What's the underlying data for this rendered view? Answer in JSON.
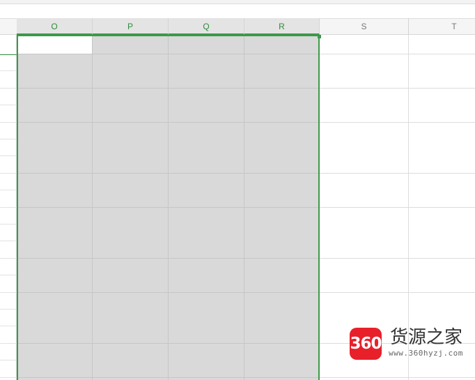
{
  "spreadsheet": {
    "columns": [
      {
        "label": "O",
        "selected": true
      },
      {
        "label": "P",
        "selected": true
      },
      {
        "label": "Q",
        "selected": true
      },
      {
        "label": "R",
        "selected": true
      },
      {
        "label": "S",
        "selected": false
      },
      {
        "label": "T",
        "selected": false
      }
    ],
    "selection_color": "#3b9a48",
    "selected_fill": "#d9d9d9",
    "active_cell": {
      "column": "O",
      "row_index": 0
    }
  },
  "watermark": {
    "logo_text": "360",
    "title": "货源之家",
    "url": "www.360hyzj.com",
    "logo_color": "#e8202a"
  }
}
